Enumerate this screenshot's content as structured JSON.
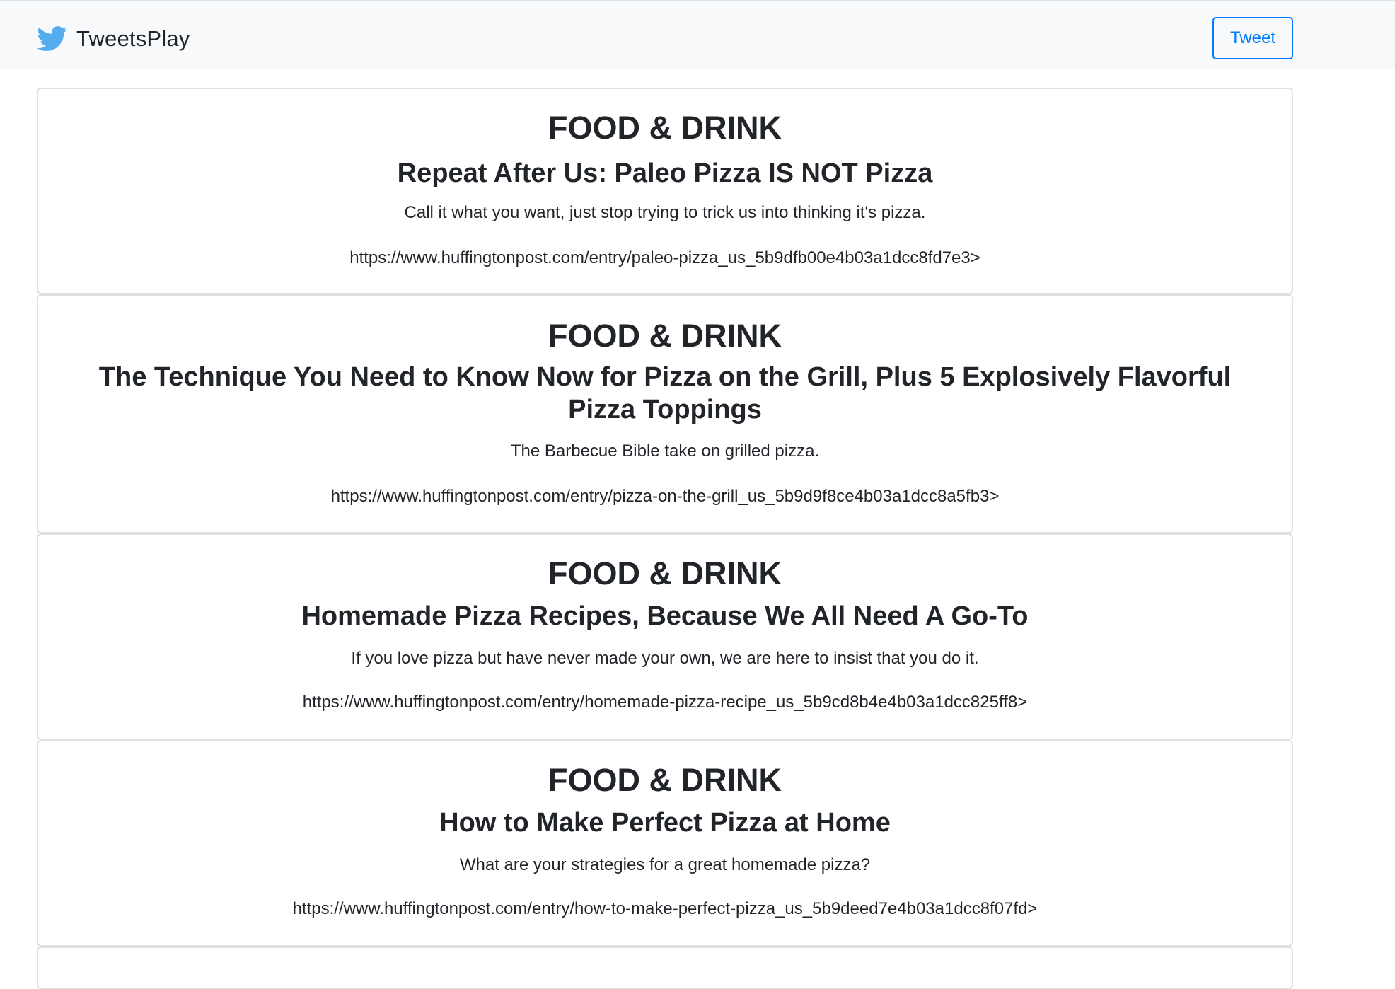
{
  "navbar": {
    "brand": "TweetsPlay",
    "brand_icon": "twitter-bird-icon",
    "brand_icon_color": "#55acee",
    "tweet_label": "Tweet",
    "accent_color": "#007bff"
  },
  "articles": [
    {
      "category": "FOOD & DRINK",
      "headline": "Repeat After Us: Paleo Pizza IS NOT Pizza",
      "description": "Call it what you want, just stop trying to trick us into thinking it's pizza.",
      "link": "https://www.huffingtonpost.com/entry/paleo-pizza_us_5b9dfb00e4b03a1dcc8fd7e3>"
    },
    {
      "category": "FOOD & DRINK",
      "headline": "The Technique You Need to Know Now for Pizza on the Grill, Plus 5 Explosively Flavorful Pizza Toppings",
      "description": "The Barbecue Bible take on grilled pizza.",
      "link": "https://www.huffingtonpost.com/entry/pizza-on-the-grill_us_5b9d9f8ce4b03a1dcc8a5fb3>"
    },
    {
      "category": "FOOD & DRINK",
      "headline": "Homemade Pizza Recipes, Because We All Need A Go-To",
      "description": "If you love pizza but have never made your own, we are here to insist that you do it.",
      "link": "https://www.huffingtonpost.com/entry/homemade-pizza-recipe_us_5b9cd8b4e4b03a1dcc825ff8>"
    },
    {
      "category": "FOOD & DRINK",
      "headline": "How to Make Perfect Pizza at Home",
      "description": "What are your strategies for a great homemade pizza?",
      "link": "https://www.huffingtonpost.com/entry/how-to-make-perfect-pizza_us_5b9deed7e4b03a1dcc8f07fd>"
    }
  ]
}
